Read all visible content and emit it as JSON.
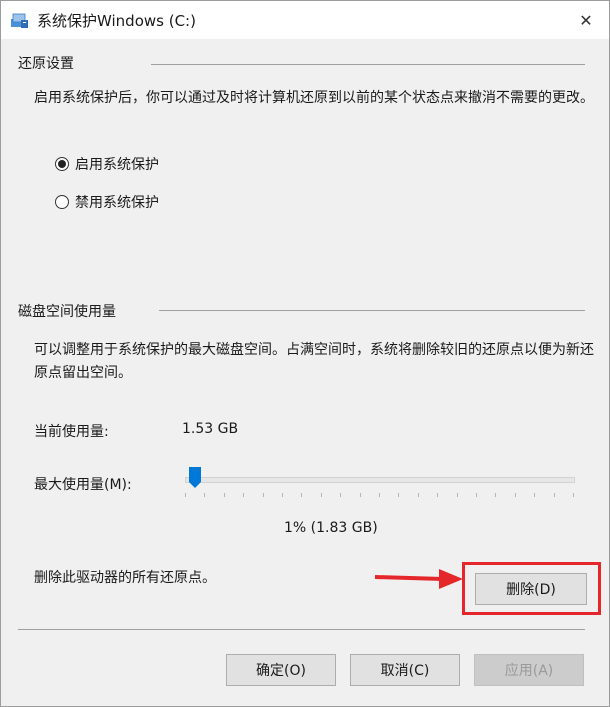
{
  "window": {
    "title": "系统保护Windows (C:)"
  },
  "restore_section": {
    "title": "还原设置",
    "description": "启用系统保护后，你可以通过及时将计算机还原到以前的某个状态点来撤消不需要的更改。",
    "options": [
      {
        "label": "启用系统保护",
        "selected": true
      },
      {
        "label": "禁用系统保护",
        "selected": false
      }
    ]
  },
  "disk_section": {
    "title": "磁盘空间使用量",
    "description": "可以调整用于系统保护的最大磁盘空间。占满空间时，系统将删除较旧的还原点以便为新还原点留出空间。",
    "current_usage_label": "当前使用量:",
    "current_usage_value": "1.53 GB",
    "max_usage_label": "最大使用量(M):",
    "max_usage_percent": 1,
    "max_usage_readout": "1% (1.83 GB)",
    "delete_text": "删除此驱动器的所有还原点。",
    "delete_button": "删除(D)"
  },
  "footer": {
    "ok": "确定(O)",
    "cancel": "取消(C)",
    "apply": "应用(A)"
  },
  "colors": {
    "highlight": "#e5262b",
    "slider_thumb": "#0078d7"
  }
}
